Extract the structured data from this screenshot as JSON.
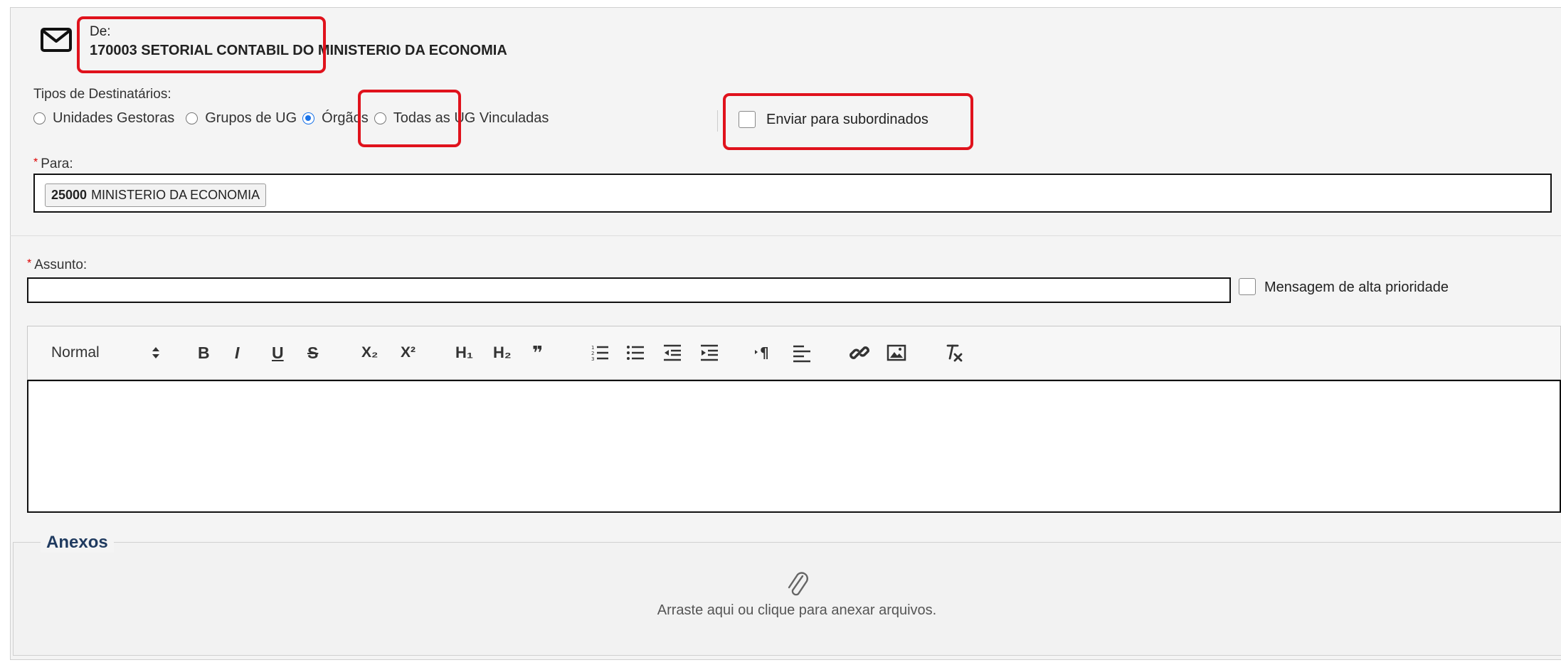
{
  "header": {
    "from_label": "De:",
    "from_value": "170003 SETORIAL CONTABIL DO MINISTERIO DA ECONOMIA",
    "icon": "mail-icon"
  },
  "recipients": {
    "types_label": "Tipos de Destinatários:",
    "options": [
      {
        "label": "Unidades Gestoras",
        "checked": false
      },
      {
        "label": "Grupos de UG",
        "checked": false
      },
      {
        "label": "Órgãos",
        "checked": true
      },
      {
        "label": "Todas as UG Vinculadas",
        "checked": false
      }
    ],
    "subordinates_label": "Enviar para subordinados",
    "subordinates_checked": false
  },
  "para": {
    "label": "Para:",
    "tag_code": "25000",
    "tag_name": "MINISTERIO DA ECONOMIA"
  },
  "assunto": {
    "label": "Assunto:",
    "value": "",
    "priority_label": "Mensagem de alta prioridade",
    "priority_checked": false
  },
  "toolbar": {
    "format_select": "Normal",
    "bold": "B",
    "italic": "I",
    "underline": "U",
    "strike": "S",
    "subscript": "X₂",
    "superscript": "X²",
    "h1": "H₁",
    "h2": "H₂",
    "blockquote": "❞"
  },
  "anexos": {
    "title": "Anexos",
    "drop_text": "Arraste aqui ou clique para anexar arquivos."
  },
  "colors": {
    "highlight": "#e0121c",
    "radio_accent": "#1a73e8",
    "anexos_title": "#1f3a5f"
  }
}
